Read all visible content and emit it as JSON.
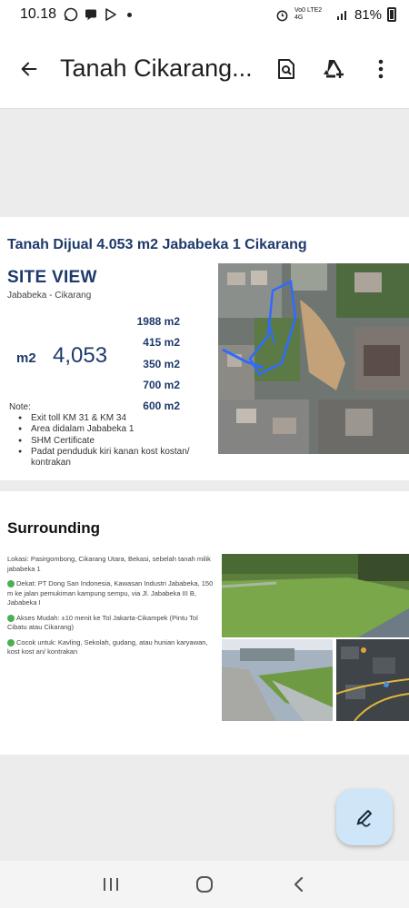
{
  "status": {
    "time": "10.18",
    "network": "Vo0 LTE2 4G",
    "battery": "81%"
  },
  "appbar": {
    "title": "Tanah Cikarang...",
    "back_label": "Back",
    "actions": [
      "find-in-page-icon",
      "drive-add-icon",
      "more-vert-icon"
    ]
  },
  "slide1": {
    "title": "Tanah Dijual 4.053 m2 Jababeka 1 Cikarang",
    "heading": "SITE VIEW",
    "location": "Jababeka - Cikarang",
    "areas": [
      "1988 m2",
      "415 m2",
      "350 m2",
      "700 m2",
      "600 m2"
    ],
    "total_label": "m2",
    "total_value": "4,053",
    "note_label": "Note:",
    "notes": [
      "Exit toll KM 31 & KM 34",
      "Area didalam Jababeka 1",
      "SHM Certificate",
      "Padat penduduk kiri kanan kost kostan/ kontrakan"
    ]
  },
  "slide2": {
    "title": "Surrounding",
    "paragraphs": [
      "Lokasi: Pasirgombong, Cikarang Utara, Bekasi, sebelah tanah milik jababeka 1",
      "Dekat: PT Dong San Indonesia, Kawasan Industri Jababeka, 150 m ke jalan pemukiman kampung sempu, via Jl. Jababeka III B, Jababeka I",
      "Akses Mudah: ±10 menit ke Tol Jakarta-Cikampek (Pintu Tol Cibatu atau Cikarang)",
      "Cocok untuk: Kavling, Sekolah, gudang, atau hunian karyawan, kost kost an/  kontrakan"
    ]
  },
  "colors": {
    "accent": "#1e3a6b",
    "fab": "#cfe6f8",
    "bullet_green": "#4caf50"
  }
}
